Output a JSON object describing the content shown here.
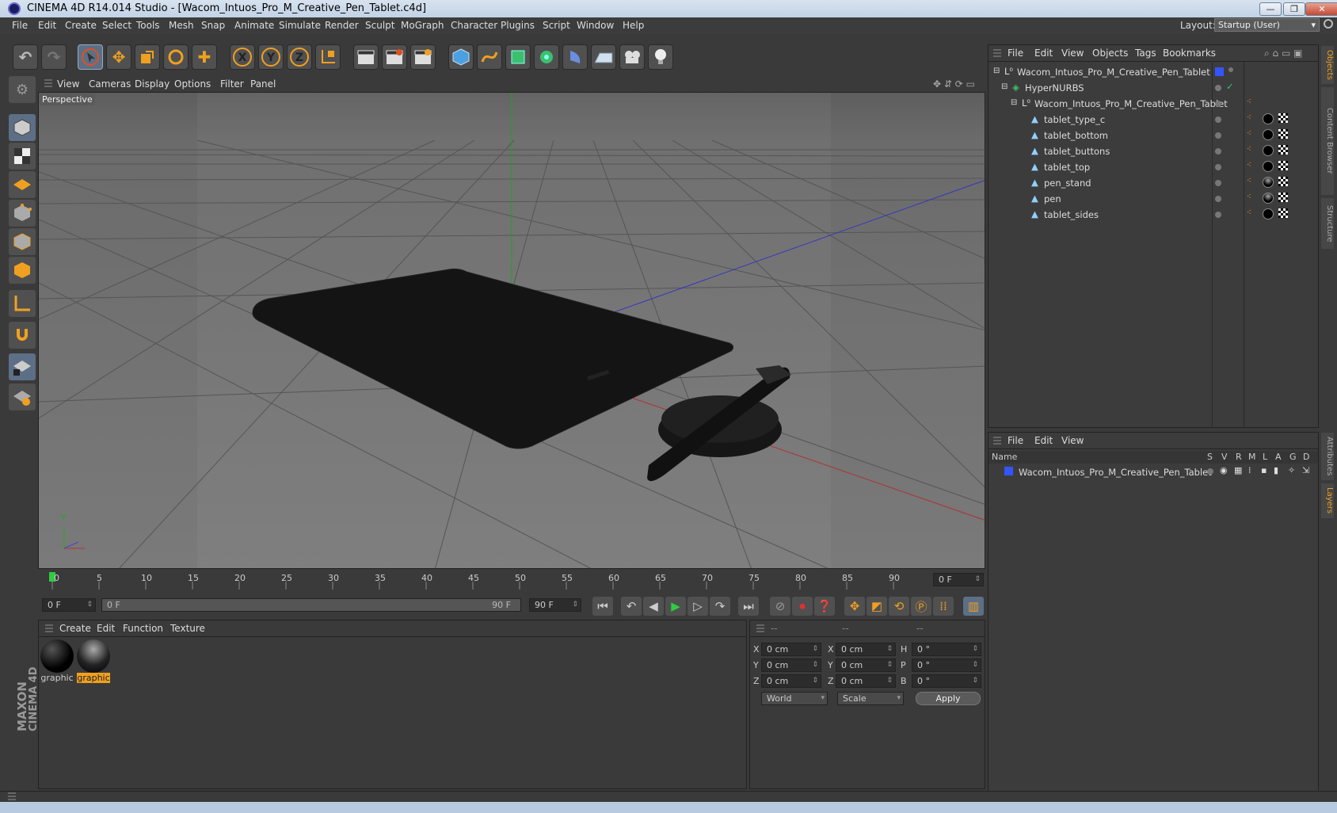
{
  "window": {
    "title": "CINEMA 4D R14.014 Studio - [Wacom_Intuos_Pro_M_Creative_Pen_Tablet.c4d]",
    "min": "—",
    "max": "❐",
    "close": "✕"
  },
  "menu": [
    "File",
    "Edit",
    "Create",
    "Select",
    "Tools",
    "Mesh",
    "Snap",
    "Animate",
    "Simulate",
    "Render",
    "Sculpt",
    "MoGraph",
    "Character",
    "Plugins",
    "Script",
    "Window",
    "Help"
  ],
  "layout": {
    "label": "Layout:",
    "value": "Startup (User)"
  },
  "toolbar": {
    "undo": "↶",
    "redo": "↷",
    "x": "X",
    "y": "Y",
    "z": "Z"
  },
  "viewport": {
    "menu": [
      "View",
      "Cameras",
      "Display",
      "Options",
      "Filter",
      "Panel"
    ],
    "label": "Perspective"
  },
  "timeline": {
    "ticks": [
      "0",
      "5",
      "10",
      "15",
      "20",
      "25",
      "30",
      "35",
      "40",
      "45",
      "50",
      "55",
      "60",
      "65",
      "70",
      "75",
      "80",
      "85",
      "90"
    ],
    "frame_display": "0 F"
  },
  "transport": {
    "start": "0 F",
    "range_start": "0 F",
    "range_end": "90 F",
    "end": "90 F"
  },
  "materials": {
    "menu": [
      "Create",
      "Edit",
      "Function",
      "Texture"
    ],
    "items": [
      {
        "label": "graphic",
        "selected": false
      },
      {
        "label": "graphic",
        "selected": true
      }
    ]
  },
  "attributes": {
    "headers": [
      "--",
      "--",
      "--"
    ],
    "rows": [
      {
        "a": "X",
        "av": "0 cm",
        "b": "X",
        "bv": "0 cm",
        "c": "H",
        "cv": "0 °"
      },
      {
        "a": "Y",
        "av": "0 cm",
        "b": "Y",
        "bv": "0 cm",
        "c": "P",
        "cv": "0 °"
      },
      {
        "a": "Z",
        "av": "0 cm",
        "b": "Z",
        "bv": "0 cm",
        "c": "B",
        "cv": "0 °"
      }
    ],
    "coord_system": "World",
    "mode": "Scale",
    "apply": "Apply"
  },
  "objects": {
    "menu": [
      "File",
      "Edit",
      "View",
      "Objects",
      "Tags",
      "Bookmarks"
    ],
    "tree": [
      {
        "name": "Wacom_Intuos_Pro_M_Creative_Pen_Tablet",
        "depth": 0
      },
      {
        "name": "HyperNURBS",
        "depth": 1
      },
      {
        "name": "Wacom_Intuos_Pro_M_Creative_Pen_Tablet",
        "depth": 2
      },
      {
        "name": "tablet_type_c",
        "depth": 3
      },
      {
        "name": "tablet_bottom",
        "depth": 3
      },
      {
        "name": "tablet_buttons",
        "depth": 3
      },
      {
        "name": "tablet_top",
        "depth": 3
      },
      {
        "name": "pen_stand",
        "depth": 3
      },
      {
        "name": "pen",
        "depth": 3
      },
      {
        "name": "tablet_sides",
        "depth": 3
      }
    ]
  },
  "layers": {
    "menu": [
      "File",
      "Edit",
      "View"
    ],
    "columns": [
      "Name",
      "S",
      "V",
      "R",
      "M",
      "L",
      "A",
      "G",
      "D"
    ],
    "rows": [
      {
        "name": "Wacom_Intuos_Pro_M_Creative_Pen_Tablet",
        "color": "#3355ff"
      }
    ]
  },
  "right_tabs": [
    "Objects",
    "Content Browser",
    "Structure",
    "Attributes",
    "Layers"
  ],
  "brand": {
    "line1": "MAXON",
    "line2": "CINEMA 4D"
  },
  "colors": {
    "accent": "#f0a020",
    "selection": "#5c6f86",
    "layer": "#3355ff"
  }
}
